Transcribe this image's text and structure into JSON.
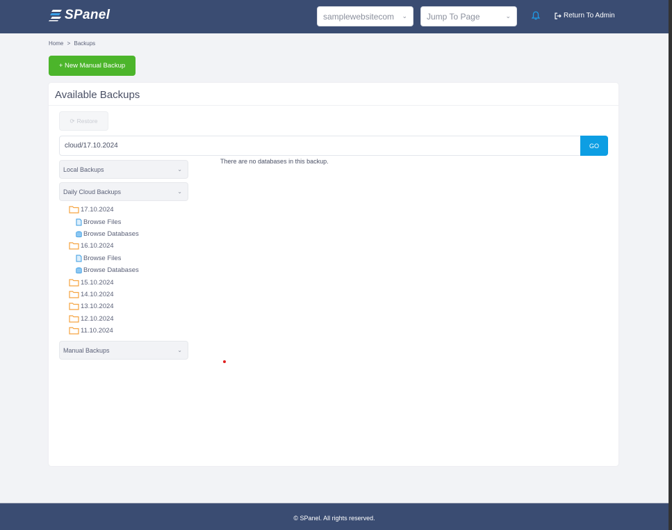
{
  "header": {
    "brand": "SPanel",
    "site_select": {
      "value": "samplewebsitecom"
    },
    "jump_select": {
      "placeholder": "Jump To Page"
    },
    "return_label": "Return To Admin",
    "icons": {
      "bell": "bell-icon",
      "return": "sign-out-icon",
      "logo": "spanel-logo-icon"
    }
  },
  "breadcrumb": {
    "home": "Home",
    "separator": ">",
    "current": "Backups"
  },
  "actions": {
    "new_backup_label": "+ New Manual Backup"
  },
  "card": {
    "title": "Available Backups",
    "restore_label": "Restore",
    "path_value": "cloud/17.10.2024",
    "go_label": "GO",
    "empty_message": "There are no databases in this backup."
  },
  "sidebar": {
    "local": "Local Backups",
    "daily": "Daily Cloud Backups",
    "manual": "Manual Backups",
    "browse_files": "Browse Files",
    "browse_databases": "Browse Databases",
    "daily_dates": [
      "17.10.2024",
      "16.10.2024",
      "15.10.2024",
      "14.10.2024",
      "13.10.2024",
      "12.10.2024",
      "11.10.2024"
    ]
  },
  "footer": {
    "text": "© SPanel. All rights reserved."
  },
  "colors": {
    "header_bg": "#3a4c72",
    "primary_green": "#4cb52b",
    "go_blue": "#0d9ee3",
    "folder_orange": "#f5a340",
    "page_bg": "#f2f3f6"
  }
}
